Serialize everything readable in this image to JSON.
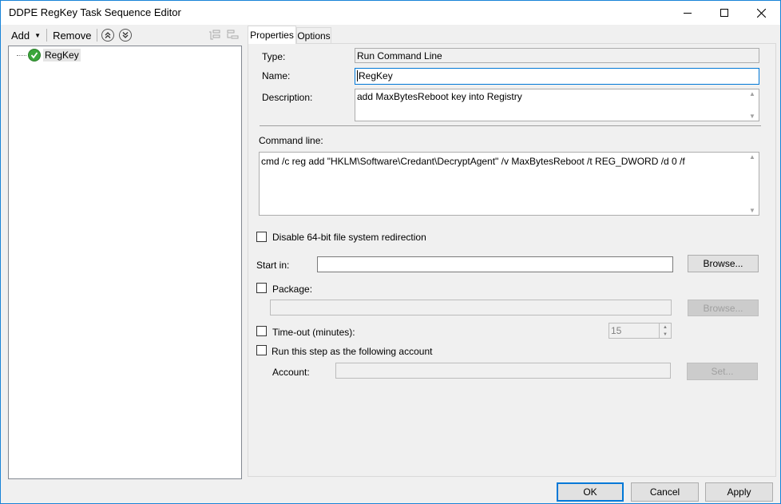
{
  "window": {
    "title": "DDPE RegKey Task Sequence Editor"
  },
  "toolbar": {
    "add_label": "Add",
    "remove_label": "Remove"
  },
  "tree": {
    "items": [
      {
        "label": "RegKey",
        "status": "success"
      }
    ]
  },
  "tabs": [
    {
      "label": "Properties",
      "active": true
    },
    {
      "label": "Options",
      "active": false
    }
  ],
  "properties": {
    "type_label": "Type:",
    "type_value": "Run Command Line",
    "name_label": "Name:",
    "name_value": "RegKey",
    "description_label": "Description:",
    "description_value": "add MaxBytesReboot key into Registry",
    "command_label": "Command line:",
    "command_value": "cmd /c reg add \"HKLM\\Software\\Credant\\DecryptAgent\" /v MaxBytesReboot /t REG_DWORD /d 0 /f",
    "disable64_label": "Disable 64-bit file system redirection",
    "start_in_label": "Start in:",
    "start_in_value": "",
    "browse_label": "Browse...",
    "package_label": "Package:",
    "package_value": "",
    "package_browse_label": "Browse...",
    "timeout_label": "Time-out (minutes):",
    "timeout_value": "15",
    "run_as_label": "Run this step as the following account",
    "account_label": "Account:",
    "account_value": "",
    "set_label": "Set..."
  },
  "footer": {
    "ok_label": "OK",
    "cancel_label": "Cancel",
    "apply_label": "Apply"
  },
  "colors": {
    "accent": "#0078d7",
    "success": "#3aa63a"
  }
}
